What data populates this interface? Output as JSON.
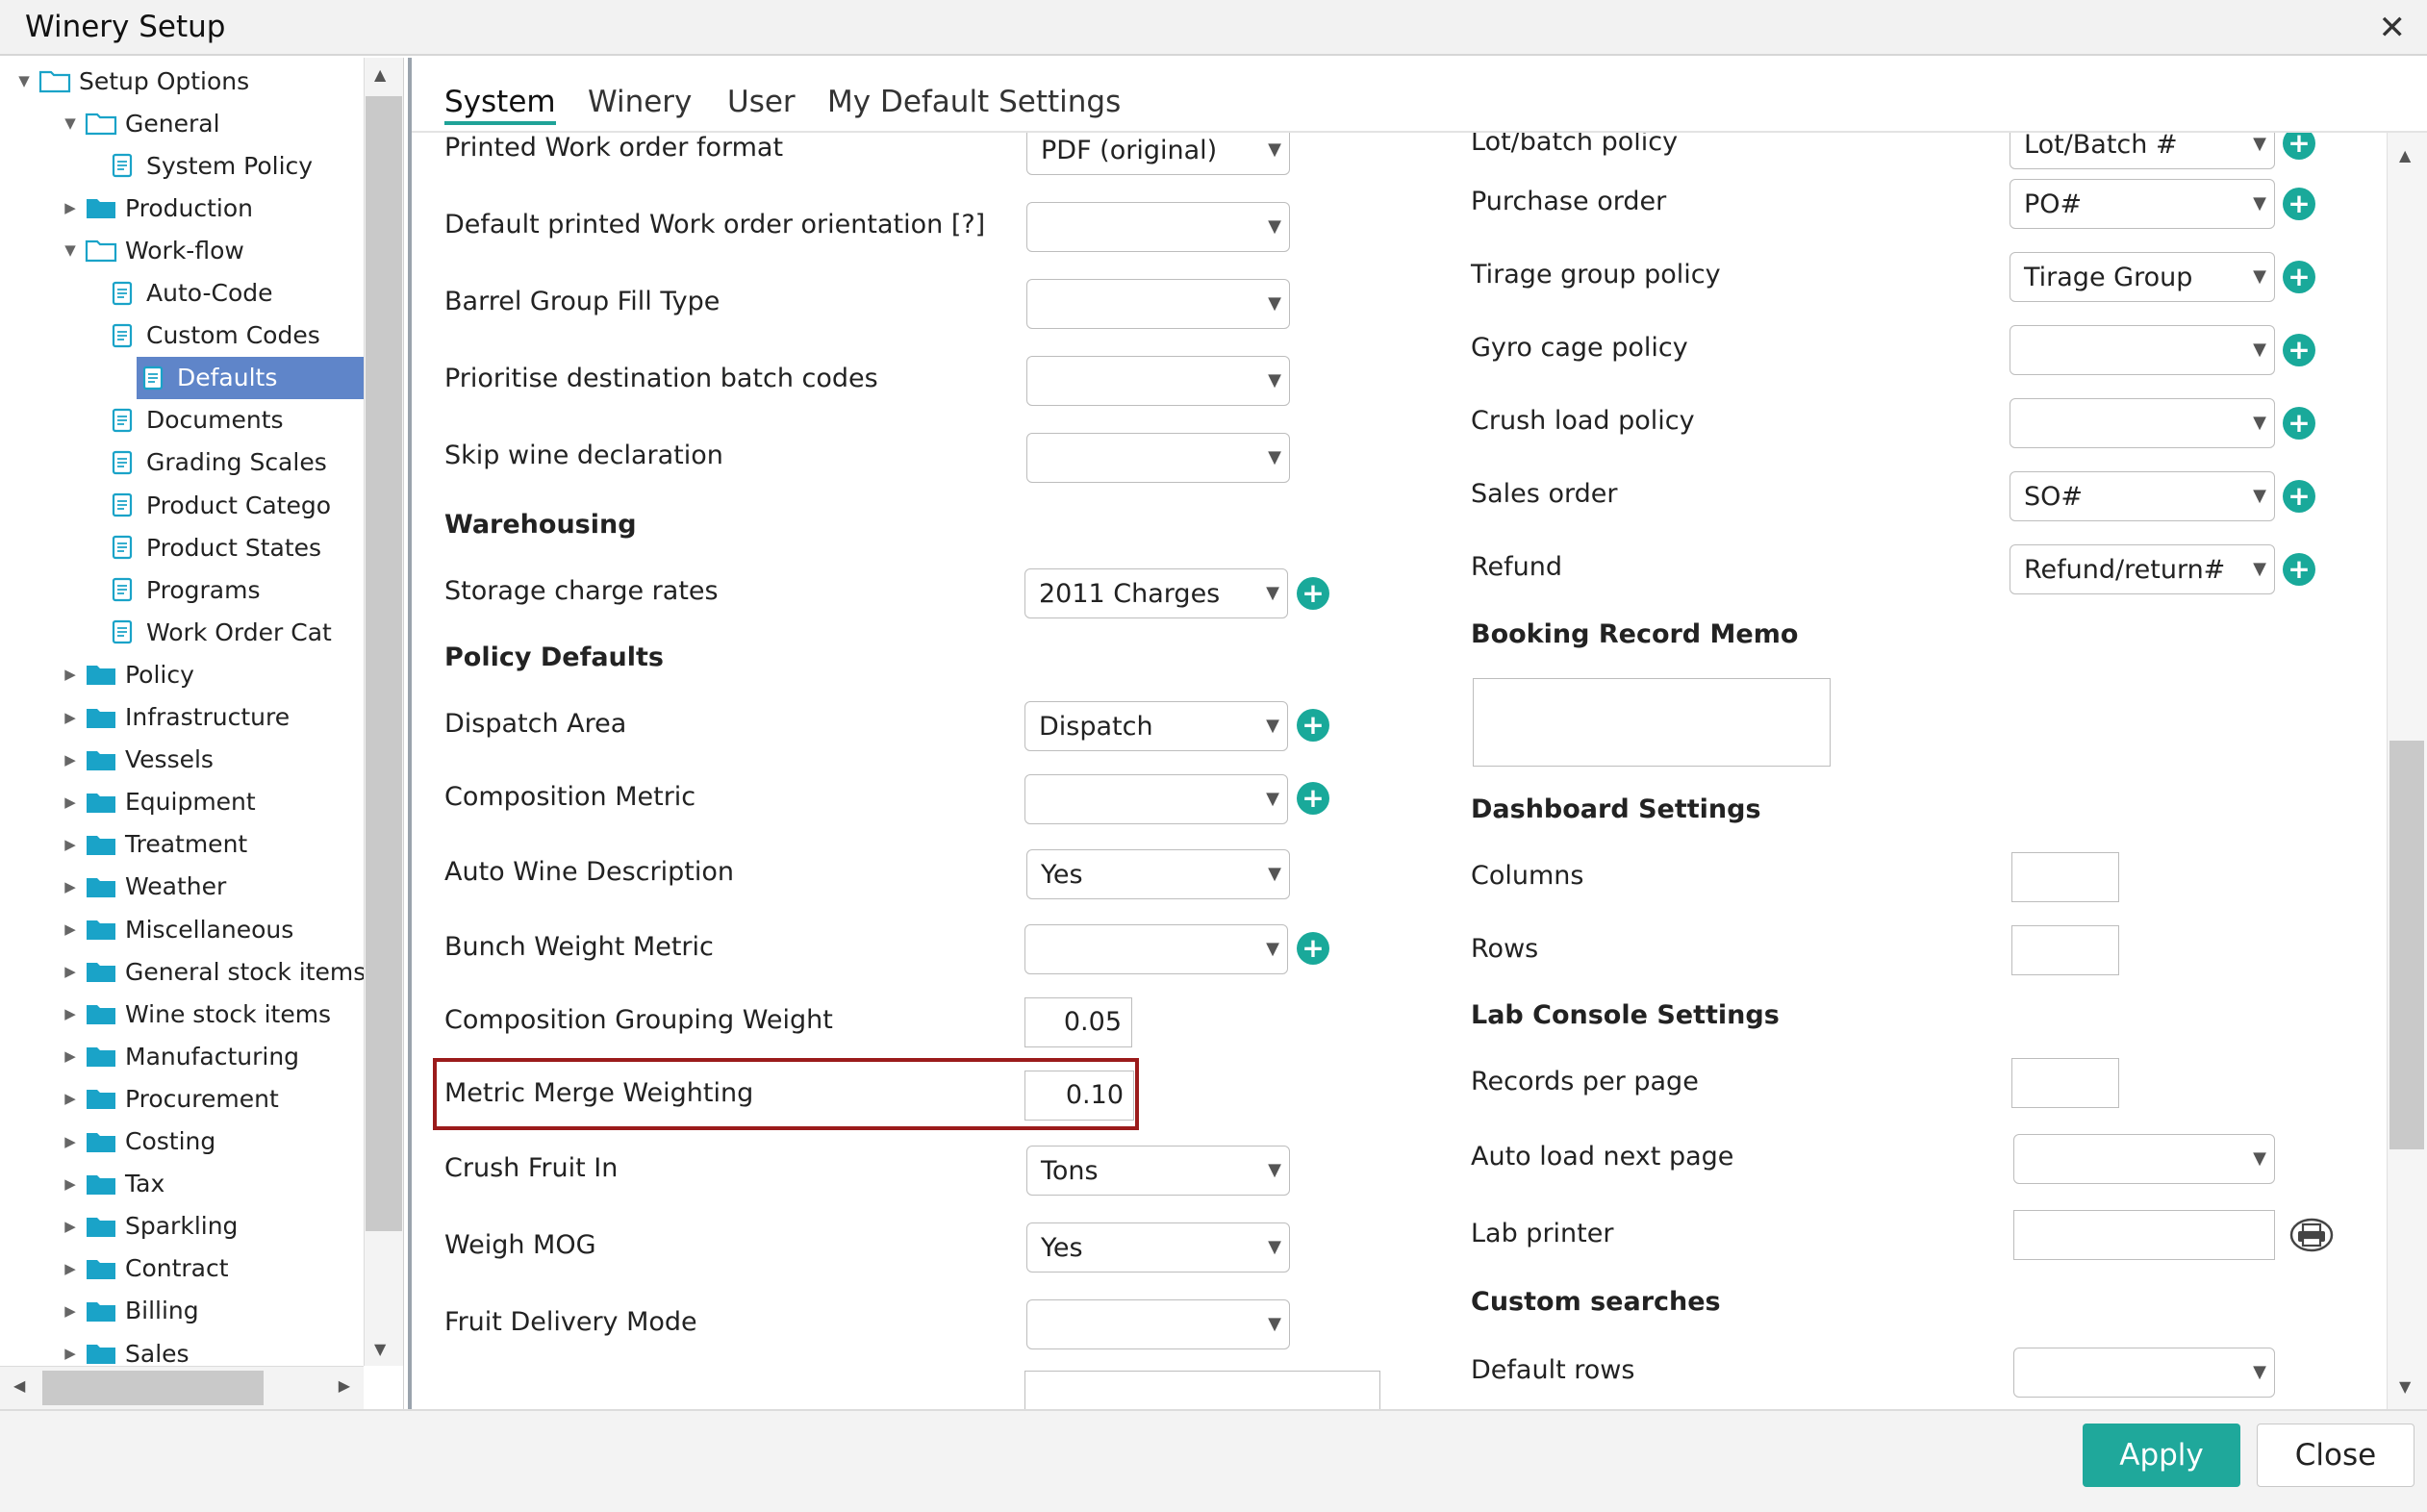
{
  "window": {
    "title": "Winery Setup",
    "close_glyph": "✕"
  },
  "tree": {
    "items": [
      {
        "label": "Setup Options",
        "icon": "folder-open-icon"
      },
      {
        "label": "General",
        "icon": "folder-open-icon"
      },
      {
        "label": "System Policy",
        "icon": "document-icon"
      },
      {
        "label": "Production",
        "icon": "folder-icon"
      },
      {
        "label": "Work-flow",
        "icon": "folder-open-icon"
      },
      {
        "label": "Auto-Code",
        "icon": "document-icon"
      },
      {
        "label": "Custom Codes",
        "icon": "document-icon"
      },
      {
        "label": "Defaults",
        "icon": "document-icon",
        "selected": true
      },
      {
        "label": "Documents",
        "icon": "document-icon"
      },
      {
        "label": "Grading Scales",
        "icon": "document-icon"
      },
      {
        "label": "Product Catego",
        "icon": "document-icon"
      },
      {
        "label": "Product States",
        "icon": "document-icon"
      },
      {
        "label": "Programs",
        "icon": "document-icon"
      },
      {
        "label": "Work Order Cat",
        "icon": "document-icon"
      },
      {
        "label": "Policy",
        "icon": "folder-icon"
      },
      {
        "label": "Infrastructure",
        "icon": "folder-icon"
      },
      {
        "label": "Vessels",
        "icon": "folder-icon"
      },
      {
        "label": "Equipment",
        "icon": "folder-icon"
      },
      {
        "label": "Treatment",
        "icon": "folder-icon"
      },
      {
        "label": "Weather",
        "icon": "folder-icon"
      },
      {
        "label": "Miscellaneous",
        "icon": "folder-icon"
      },
      {
        "label": "General stock items",
        "icon": "folder-icon"
      },
      {
        "label": "Wine stock items",
        "icon": "folder-icon"
      },
      {
        "label": "Manufacturing",
        "icon": "folder-icon"
      },
      {
        "label": "Procurement",
        "icon": "folder-icon"
      },
      {
        "label": "Costing",
        "icon": "folder-icon"
      },
      {
        "label": "Tax",
        "icon": "folder-icon"
      },
      {
        "label": "Sparkling",
        "icon": "folder-icon"
      },
      {
        "label": "Contract",
        "icon": "folder-icon"
      },
      {
        "label": "Billing",
        "icon": "folder-icon"
      },
      {
        "label": "Sales",
        "icon": "folder-icon"
      }
    ]
  },
  "tabs": [
    "System",
    "Winery",
    "User",
    "My Default Settings"
  ],
  "left_fields": {
    "printed_wo_format": {
      "label": "Printed Work order format",
      "value": "PDF (original)"
    },
    "wo_orientation": {
      "label": "Default printed Work order orientation [?]",
      "value": ""
    },
    "barrel_fill_type": {
      "label": "Barrel Group Fill Type",
      "value": ""
    },
    "prioritise_batch": {
      "label": "Prioritise destination batch codes",
      "value": ""
    },
    "skip_wine_decl": {
      "label": "Skip wine declaration",
      "value": ""
    },
    "warehousing_heading": "Warehousing",
    "storage_rates": {
      "label": "Storage charge rates",
      "value": "2011 Charges"
    },
    "policy_defaults_heading": "Policy Defaults",
    "dispatch_area": {
      "label": "Dispatch Area",
      "value": "Dispatch"
    },
    "composition_metric": {
      "label": "Composition Metric",
      "value": ""
    },
    "auto_wine_desc": {
      "label": "Auto Wine Description",
      "value": "Yes"
    },
    "bunch_weight_metric": {
      "label": "Bunch Weight Metric",
      "value": ""
    },
    "composition_grouping": {
      "label": "Composition Grouping Weight",
      "value": "0.05"
    },
    "metric_merge": {
      "label": "Metric Merge Weighting",
      "value": "0.10"
    },
    "crush_fruit_in": {
      "label": "Crush Fruit In",
      "value": "Tons"
    },
    "weigh_mog": {
      "label": "Weigh MOG",
      "value": "Yes"
    },
    "fruit_delivery": {
      "label": "Fruit Delivery Mode",
      "value": ""
    }
  },
  "right_fields": {
    "lot_batch_policy": {
      "label": "Lot/batch policy",
      "value": "Lot/Batch #"
    },
    "purchase_order": {
      "label": "Purchase order",
      "value": "PO#"
    },
    "tirage_group": {
      "label": "Tirage group policy",
      "value": "Tirage Group"
    },
    "gyro_cage": {
      "label": "Gyro cage policy",
      "value": ""
    },
    "crush_load": {
      "label": "Crush load policy",
      "value": ""
    },
    "sales_order": {
      "label": "Sales order",
      "value": "SO#"
    },
    "refund": {
      "label": "Refund",
      "value": "Refund/return#"
    },
    "booking_memo_heading": "Booking Record Memo",
    "dashboard_heading": "Dashboard Settings",
    "columns": {
      "label": "Columns",
      "value": ""
    },
    "rows": {
      "label": "Rows",
      "value": ""
    },
    "lab_console_heading": "Lab Console Settings",
    "records_per_page": {
      "label": "Records per page",
      "value": ""
    },
    "auto_load_next": {
      "label": "Auto load next page",
      "value": ""
    },
    "lab_printer": {
      "label": "Lab printer",
      "value": ""
    },
    "custom_searches_heading": "Custom searches",
    "default_rows": {
      "label": "Default rows",
      "value": ""
    }
  },
  "glyphs": {
    "caret": "▼",
    "add": "+",
    "tree_collapsed": "▶",
    "tree_expanded": "▼",
    "scroll_up": "▲",
    "scroll_down": "▼",
    "scroll_left": "◀",
    "scroll_right": "▶"
  },
  "footer": {
    "apply_label": "Apply",
    "close_label": "Close"
  },
  "colors": {
    "accent": "#1fa89b",
    "selected_row": "#5f85c9",
    "highlight_border": "#9b1b1b",
    "folder": "#1aa3c8"
  }
}
